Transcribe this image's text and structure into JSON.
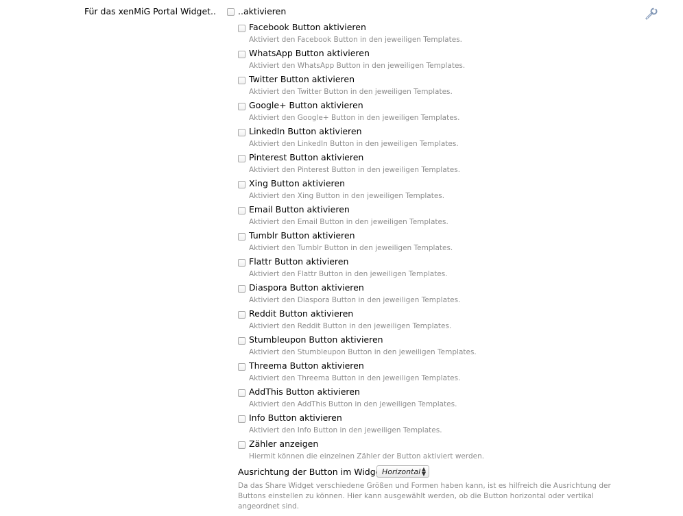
{
  "main": {
    "label": "Für das xenMiG Portal Widget..",
    "checkbox_label": "..aktivieren",
    "settings_icon": "wrench-icon"
  },
  "options": [
    {
      "label": "Facebook Button aktivieren",
      "hint": "Aktiviert den Facebook Button in den jeweiligen Templates."
    },
    {
      "label": "WhatsApp Button aktivieren",
      "hint": "Aktiviert den WhatsApp Button in den jeweiligen Templates."
    },
    {
      "label": "Twitter Button aktivieren",
      "hint": "Aktiviert den Twitter Button in den jeweiligen Templates."
    },
    {
      "label": "Google+ Button aktivieren",
      "hint": "Aktiviert den Google+ Button in den jeweiligen Templates."
    },
    {
      "label": "LinkedIn Button aktivieren",
      "hint": "Aktiviert den LinkedIn Button in den jeweiligen Templates."
    },
    {
      "label": "Pinterest Button aktivieren",
      "hint": "Aktiviert den Pinterest Button in den jeweiligen Templates."
    },
    {
      "label": "Xing Button aktivieren",
      "hint": "Aktiviert den Xing Button in den jeweiligen Templates."
    },
    {
      "label": "Email Button aktivieren",
      "hint": "Aktiviert den Email Button in den jeweiligen Templates."
    },
    {
      "label": "Tumblr Button aktivieren",
      "hint": "Aktiviert den Tumblr Button in den jeweiligen Templates."
    },
    {
      "label": "Flattr Button aktivieren",
      "hint": "Aktiviert den Flattr Button in den jeweiligen Templates."
    },
    {
      "label": "Diaspora Button aktivieren",
      "hint": "Aktiviert den Diaspora Button in den jeweiligen Templates."
    },
    {
      "label": "Reddit Button aktivieren",
      "hint": "Aktiviert den Reddit Button in den jeweiligen Templates."
    },
    {
      "label": "Stumbleupon Button aktivieren",
      "hint": "Aktiviert den Stumbleupon Button in den jeweiligen Templates."
    },
    {
      "label": "Threema Button aktivieren",
      "hint": "Aktiviert den Threema Button in den jeweiligen Templates."
    },
    {
      "label": "AddThis Button aktivieren",
      "hint": "Aktiviert den AddThis Button in den jeweiligen Templates."
    },
    {
      "label": "Info Button aktivieren",
      "hint": "Aktiviert den Info Button in den jeweiligen Templates."
    },
    {
      "label": "Zähler anzeigen",
      "hint": "Hiermit können die einzelnen Zähler der Button aktiviert werden."
    }
  ],
  "alignment": {
    "label": "Ausrichtung der Button im Widget",
    "selected": "Horizontal",
    "hint": "Da das Share Widget verschiedene Größen und Formen haben kann, ist es hilfreich die Ausrichtung der Buttons einstellen zu können. Hier kann ausgewählt werden, ob die Button horizontal oder vertikal angeordnet sind."
  }
}
